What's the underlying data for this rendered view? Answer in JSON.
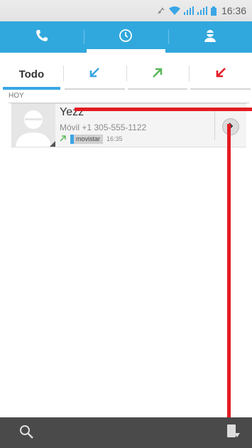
{
  "status_bar": {
    "time": "16:36",
    "icons": [
      "mute-icon",
      "wifi-icon",
      "signal-icon",
      "signal-2-icon",
      "battery-icon"
    ]
  },
  "top_tabs": [
    {
      "icon": "phone-icon",
      "active": false
    },
    {
      "icon": "clock-icon",
      "active": true
    },
    {
      "icon": "contacts-icon",
      "active": false
    }
  ],
  "filter_tabs": {
    "all_label": "Todo",
    "items": [
      {
        "icon": "incoming-call-icon",
        "color": "#3aa6e6"
      },
      {
        "icon": "outgoing-call-icon",
        "color": "#5cb85c"
      },
      {
        "icon": "missed-call-icon",
        "color": "#e41c23"
      }
    ]
  },
  "section_header": "HOY",
  "call_log": [
    {
      "name": "Yezz",
      "detail": "Móvil +1 305-555-1122",
      "carrier": "movistar",
      "time": "16:35",
      "call_type_icon": "outgoing-call-icon"
    }
  ],
  "bottom_bar": {
    "icons": [
      "search-icon",
      "dialpad-icon"
    ]
  },
  "colors": {
    "accent": "#31a8dd",
    "annotation": "#e41c23",
    "bottom_bar": "#4a4a4a"
  }
}
